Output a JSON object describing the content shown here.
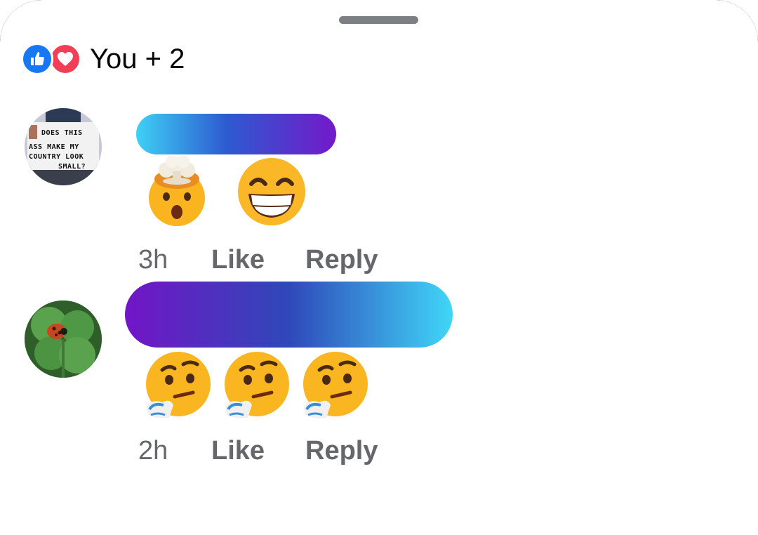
{
  "reactions": {
    "icons": [
      "like-icon",
      "love-icon"
    ],
    "summary": "You + 2",
    "colors": {
      "like": "#1877f2",
      "love": "#f33e58"
    }
  },
  "comments": [
    {
      "avatar": "protest-sign-avatar",
      "avatar_sign_text": [
        "DOES THIS",
        "ASS MAKE MY",
        "COUNTRY LOOK",
        "SMALL?"
      ],
      "bubble_gradient": [
        "#3fd0f5",
        "#2d5bd0",
        "#7419c9"
      ],
      "emojis": [
        "exploding-head-emoji",
        "grinning-squinting-face-emoji"
      ],
      "time": "3h",
      "like_label": "Like",
      "reply_label": "Reply"
    },
    {
      "avatar": "ladybug-clover-avatar",
      "bubble_gradient": [
        "#7215c6",
        "#2f48b9",
        "#40d6f7"
      ],
      "emojis": [
        "thinking-face-emoji",
        "thinking-face-emoji",
        "thinking-face-emoji"
      ],
      "time": "2h",
      "like_label": "Like",
      "reply_label": "Reply"
    }
  ]
}
